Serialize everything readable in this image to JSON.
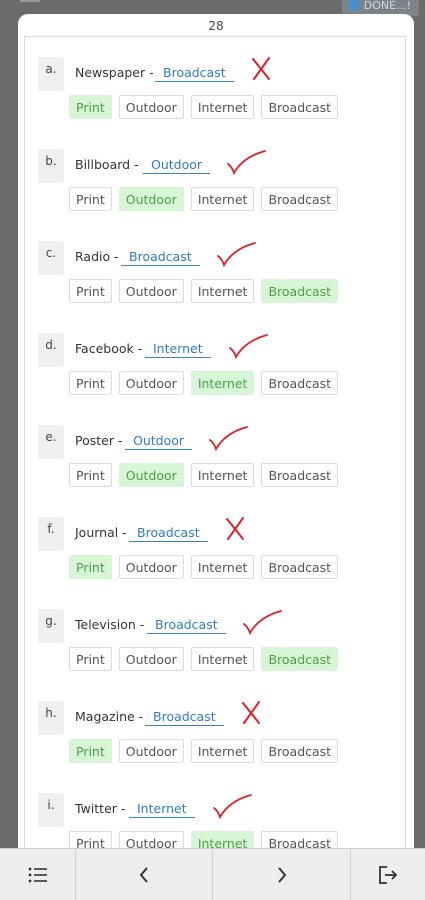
{
  "header": {
    "done_label": "DONE...!"
  },
  "page": {
    "number": "28"
  },
  "colors": {
    "correct_tick": "#e0202a",
    "wrong_cross": "#e0202a",
    "selected_bg": "#d8f5d6",
    "selected_text": "#4aa14a",
    "answer_text": "#2f7bbf"
  },
  "items": [
    {
      "letter": "a.",
      "label": "Newspaper -",
      "answer": "Broadcast",
      "result": "wrong",
      "options": [
        "Print",
        "Outdoor",
        "Internet",
        "Broadcast"
      ],
      "selected": 0
    },
    {
      "letter": "b.",
      "label": "Billboard -",
      "answer": "Outdoor",
      "result": "correct",
      "options": [
        "Print",
        "Outdoor",
        "Internet",
        "Broadcast"
      ],
      "selected": 1
    },
    {
      "letter": "c.",
      "label": "Radio -",
      "answer": "Broadcast",
      "result": "correct",
      "options": [
        "Print",
        "Outdoor",
        "Internet",
        "Broadcast"
      ],
      "selected": 3
    },
    {
      "letter": "d.",
      "label": "Facebook -",
      "answer": "Internet",
      "result": "correct",
      "options": [
        "Print",
        "Outdoor",
        "Internet",
        "Broadcast"
      ],
      "selected": 2
    },
    {
      "letter": "e.",
      "label": "Poster -",
      "answer": "Outdoor",
      "result": "correct",
      "options": [
        "Print",
        "Outdoor",
        "Internet",
        "Broadcast"
      ],
      "selected": 1
    },
    {
      "letter": "f.",
      "label": "Journal -",
      "answer": "Broadcast",
      "result": "wrong",
      "options": [
        "Print",
        "Outdoor",
        "Internet",
        "Broadcast"
      ],
      "selected": 0
    },
    {
      "letter": "g.",
      "label": "Television -",
      "answer": "Broadcast",
      "result": "correct",
      "options": [
        "Print",
        "Outdoor",
        "Internet",
        "Broadcast"
      ],
      "selected": 3
    },
    {
      "letter": "h.",
      "label": "Magazine -",
      "answer": "Broadcast",
      "result": "wrong",
      "options": [
        "Print",
        "Outdoor",
        "Internet",
        "Broadcast"
      ],
      "selected": 0
    },
    {
      "letter": "i.",
      "label": "Twitter -",
      "answer": "Internet",
      "result": "correct",
      "options": [
        "Print",
        "Outdoor",
        "Internet",
        "Broadcast"
      ],
      "selected": 2
    }
  ],
  "bottom_nav": [
    {
      "icon": "list-icon"
    },
    {
      "icon": "chevron-left-icon"
    },
    {
      "icon": "chevron-right-icon"
    },
    {
      "icon": "exit-icon"
    }
  ]
}
